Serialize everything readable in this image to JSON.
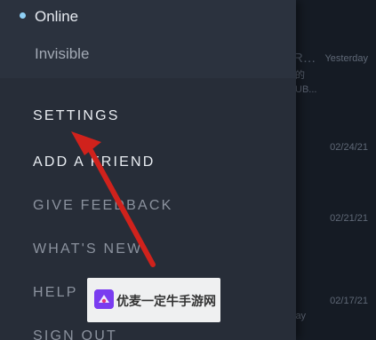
{
  "status_menu": {
    "online_label": "Online",
    "invisible_label": "Invisible"
  },
  "menu": {
    "settings": "SETTINGS",
    "add_friend": "ADD A FRIEND",
    "give_feedback": "GIVE FEEDBACK",
    "whats_new": "WHAT'S NEW",
    "help": "HELP",
    "sign_out": "SIGN OUT"
  },
  "background_chats": [
    {
      "name": "R...",
      "preview_line1": "的",
      "preview_line2": "UB...",
      "time": "Yesterday"
    },
    {
      "time": "02/24/21"
    },
    {
      "time": "02/21/21"
    },
    {
      "time": "02/17/21",
      "preview_line1": "lay"
    }
  ],
  "watermark": {
    "text": "优麦一定牛手游网"
  },
  "colors": {
    "drawer_bg": "#272d38",
    "status_dot": "#8fd0f5",
    "arrow": "#d0221c"
  }
}
